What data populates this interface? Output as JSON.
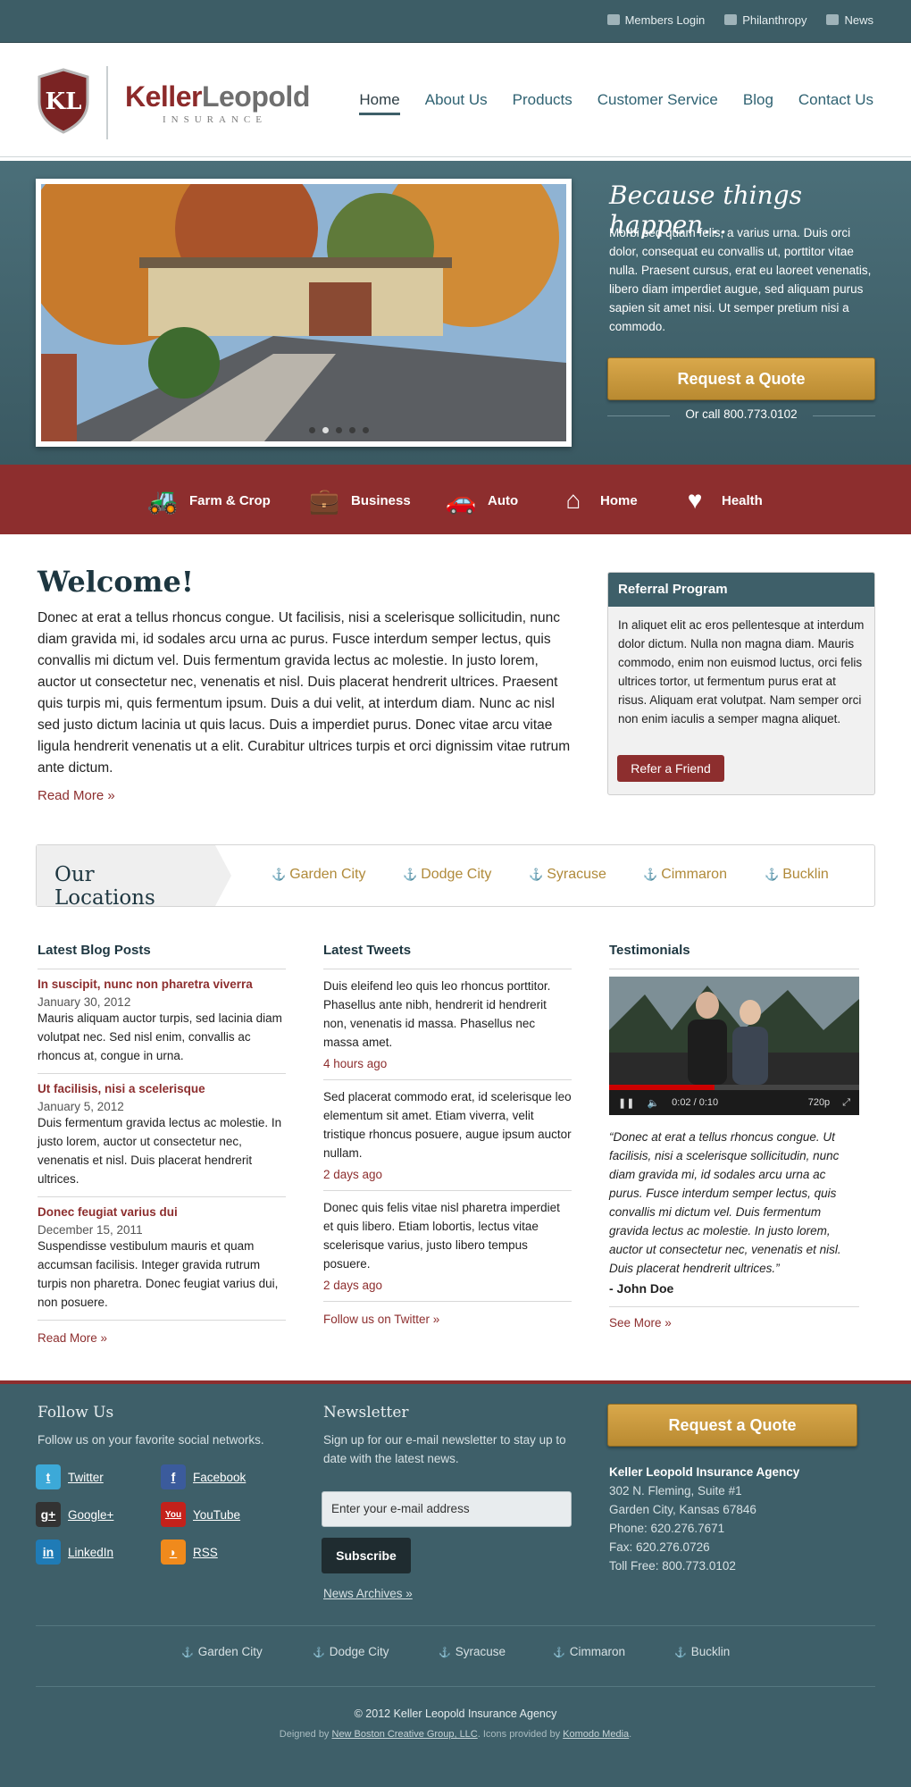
{
  "topbar": {
    "links": [
      "Members Login",
      "Philanthropy",
      "News"
    ]
  },
  "logo": {
    "initials": "KL",
    "name_a": "Keller",
    "name_b": "Leopold",
    "sub": "INSURANCE"
  },
  "nav": [
    "Home",
    "About Us",
    "Products",
    "Customer Service",
    "Blog",
    "Contact Us"
  ],
  "hero": {
    "title": "Because things happen...",
    "text": "Morbi sed quam felis, a varius urna. Duis orci dolor, consequat eu convallis ut, porttitor vitae nulla. Praesent cursus, erat eu laoreet venenatis, libero diam imperdiet augue, sed aliquam purus sapien sit amet nisi. Ut semper pretium nisi a commodo.",
    "quote_button": "Request a Quote",
    "call": "Or call 800.773.0102"
  },
  "categories": [
    "Farm & Crop",
    "Business",
    "Auto",
    "Home",
    "Health"
  ],
  "welcome": {
    "title": "Welcome!",
    "text": "Donec at erat a tellus rhoncus congue. Ut facilisis, nisi a scelerisque sollicitudin, nunc diam gravida mi, id sodales arcu urna ac purus. Fusce interdum semper lectus, quis convallis mi dictum vel. Duis fermentum gravida lectus ac molestie. In justo lorem, auctor ut consectetur nec, venenatis et nisl. Duis placerat hendrerit ultrices. Praesent quis turpis mi, quis fermentum ipsum. Duis a dui velit, at interdum diam. Nunc ac nisl sed justo dictum lacinia ut quis lacus. Duis a imperdiet purus. Donec vitae arcu vitae ligula hendrerit venenatis ut a elit. Curabitur ultrices turpis et orci dignissim vitae rutrum ante dictum.",
    "read_more": "Read More »"
  },
  "referral": {
    "title": "Referral Program",
    "text": "In aliquet elit ac eros pellentesque at interdum dolor dictum. Nulla non magna diam. Mauris commodo, enim non euismod luctus, orci felis ultrices tortor, ut fermentum purus erat at risus. Aliquam erat volutpat. Nam semper orci non enim iaculis a semper magna aliquet.",
    "button": "Refer a Friend"
  },
  "locations": {
    "title": "Our Locations",
    "items": [
      "Garden City",
      "Dodge City",
      "Syracuse",
      "Cimmaron",
      "Bucklin"
    ]
  },
  "blog": {
    "title": "Latest Blog Posts",
    "posts": [
      {
        "title": "In suscipit, nunc non pharetra viverra",
        "date": "January 30, 2012",
        "body": "Mauris aliquam auctor turpis, sed lacinia diam volutpat nec. Sed nisl enim, convallis ac rhoncus at, congue in urna."
      },
      {
        "title": "Ut facilisis, nisi a scelerisque",
        "date": "January 5, 2012",
        "body": "Duis fermentum gravida lectus ac molestie. In justo lorem, auctor ut consectetur nec, venenatis et nisl. Duis placerat hendrerit ultrices."
      },
      {
        "title": "Donec feugiat varius dui",
        "date": "December 15, 2011",
        "body": "Suspendisse vestibulum mauris et quam accumsan facilisis. Integer gravida rutrum turpis non pharetra. Donec feugiat varius dui, non posuere."
      }
    ],
    "more": "Read More »"
  },
  "tweets": {
    "title": "Latest Tweets",
    "items": [
      {
        "body": "Duis eleifend leo quis leo rhoncus porttitor. Phasellus ante nibh, hendrerit id hendrerit non, venenatis id massa. Phasellus nec massa amet.",
        "ago": "4 hours ago"
      },
      {
        "body": "Sed placerat commodo erat, id scelerisque leo elementum sit amet. Etiam viverra, velit tristique rhoncus posuere, augue ipsum auctor nullam.",
        "ago": "2 days ago"
      },
      {
        "body": "Donec quis felis vitae nisl pharetra imperdiet et quis libero. Etiam lobortis, lectus vitae scelerisque varius, justo libero tempus posuere.",
        "ago": "2 days ago"
      }
    ],
    "more": "Follow us on Twitter »"
  },
  "testimonials": {
    "title": "Testimonials",
    "video_time": "0:02 / 0:10",
    "video_quality": "720p",
    "quote": "“Donec at erat a tellus rhoncus congue. Ut facilisis, nisi a scelerisque sollicitudin, nunc diam gravida mi, id sodales arcu urna ac purus. Fusce interdum semper lectus, quis convallis mi dictum vel. Duis fermentum gravida lectus ac molestie. In justo lorem, auctor ut consectetur nec, venenatis et nisl. Duis placerat hendrerit ultrices.”",
    "author": "- John Doe",
    "more": "See More »"
  },
  "footer": {
    "follow_title": "Follow Us",
    "follow_text": "Follow us on your favorite social networks.",
    "social": [
      "Twitter",
      "Facebook",
      "Google+",
      "YouTube",
      "LinkedIn",
      "RSS"
    ],
    "newsletter_title": "Newsletter",
    "newsletter_text": "Sign up for our e-mail newsletter to stay up to date with the latest news.",
    "email_placeholder": "Enter your e-mail address",
    "subscribe": "Subscribe",
    "archives": "News Archives »",
    "quote_button": "Request a Quote",
    "agency": "Keller Leopold Insurance Agency",
    "address1": "302 N. Fleming, Suite #1",
    "address2": "Garden City, Kansas 67846",
    "phone": "Phone: 620.276.7671",
    "fax": "Fax: 620.276.0726",
    "tollfree": "Toll Free: 800.773.0102",
    "locations": [
      "Garden City",
      "Dodge City",
      "Syracuse",
      "Cimmaron",
      "Bucklin"
    ],
    "copyright": "© 2012 Keller Leopold Insurance Agency",
    "credit_a": "Deigned by",
    "credit_link1": "New Boston Creative Group, LLC",
    "credit_b": ". Icons provided by",
    "credit_link2": "Komodo Media",
    "credit_c": "."
  }
}
